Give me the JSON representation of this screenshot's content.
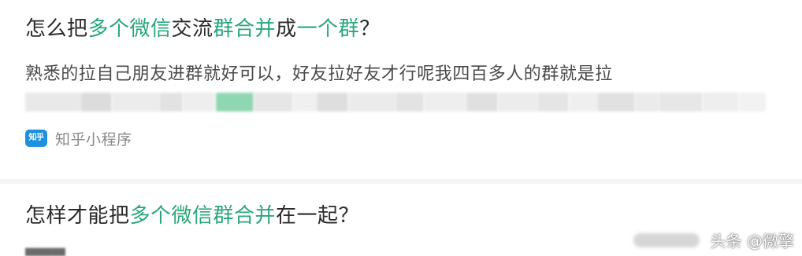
{
  "colors": {
    "highlight": "#2aa77a",
    "text": "#2b2b2b",
    "snippet": "#4a4a4a",
    "source": "#8a8a8a",
    "logo_bg": "#1f8fe0"
  },
  "results": [
    {
      "title_parts": [
        {
          "text": "怎么把",
          "hl": false
        },
        {
          "text": "多个微信",
          "hl": true
        },
        {
          "text": "交流",
          "hl": false
        },
        {
          "text": "群合并",
          "hl": true
        },
        {
          "text": "成",
          "hl": false
        },
        {
          "text": "一个群",
          "hl": true
        },
        {
          "text": "？",
          "hl": false
        }
      ],
      "snippet": "熟悉的拉自己朋友进群就好可以，好友拉好友才行呢我四百多人的群就是拉",
      "source_icon": "zhihu-logo-icon",
      "source_logo_text": "知乎",
      "source_name": "知乎小程序"
    },
    {
      "title_parts": [
        {
          "text": "怎样才能把",
          "hl": false
        },
        {
          "text": "多个微信群合并",
          "hl": true
        },
        {
          "text": "在一起？",
          "hl": false
        }
      ]
    }
  ],
  "watermark": "头条 @微擎"
}
